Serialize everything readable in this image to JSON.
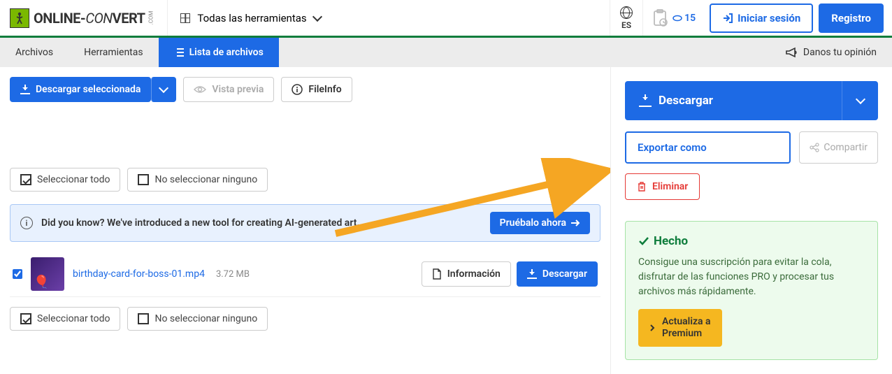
{
  "header": {
    "logo_part1": "ONLINE-",
    "logo_part2": "CON",
    "logo_part3": "VERT",
    "logo_suffix": ".COM",
    "tools_label": "Todas las herramientas",
    "lang_label": "ES",
    "credits": "15",
    "login_label": "Iniciar sesión",
    "register_label": "Registro"
  },
  "tabs": {
    "files": "Archivos",
    "tools": "Herramientas",
    "file_list": "Lista de archivos",
    "feedback": "Danos tu opinión"
  },
  "toolbar": {
    "download_selected": "Descargar seleccionada",
    "preview": "Vista previa",
    "fileinfo": "FileInfo"
  },
  "select": {
    "all": "Seleccionar todo",
    "none": "No seleccionar ninguno"
  },
  "banner": {
    "text": "Did you know? We've introduced a new tool for creating AI-generated art.",
    "cta": "Pruébalo ahora"
  },
  "file": {
    "name": "birthday-card-for-boss-01.mp4",
    "size": "3.72 MB",
    "info_btn": "Información",
    "download_btn": "Descargar"
  },
  "side": {
    "download": "Descargar",
    "export": "Exportar como",
    "share": "Compartir",
    "delete": "Eliminar",
    "done_title": "Hecho",
    "done_text": "Consigue una suscripción para evitar la cola, disfrutar de las funciones PRO y procesar tus archivos más rápidamente.",
    "upgrade_line1": "Actualiza a",
    "upgrade_line2": "Premium"
  }
}
